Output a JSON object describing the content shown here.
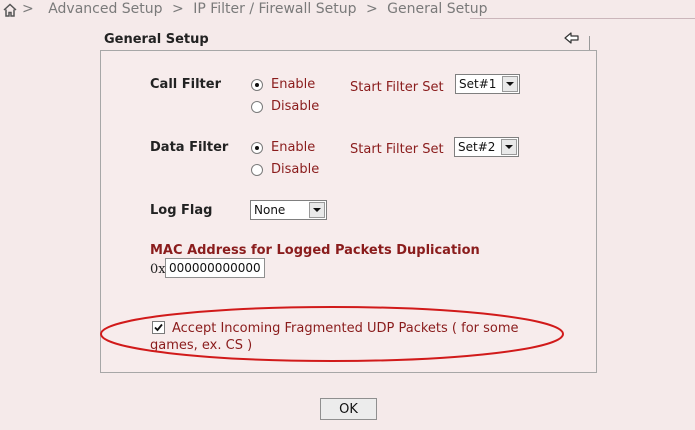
{
  "breadcrumb": {
    "items": [
      "Advanced Setup",
      "IP Filter / Firewall Setup",
      "General Setup"
    ],
    "separator": ">",
    "icon": "home-icon"
  },
  "page": {
    "title": "General Setup",
    "back_icon": "back-arrow-icon"
  },
  "call_filter": {
    "label": "Call Filter",
    "options": [
      "Enable",
      "Disable"
    ],
    "selected": "Enable",
    "start_filter_set_label": "Start Filter Set",
    "start_filter_set_value": "Set#1"
  },
  "data_filter": {
    "label": "Data Filter",
    "options": [
      "Enable",
      "Disable"
    ],
    "selected": "Enable",
    "start_filter_set_label": "Start Filter Set",
    "start_filter_set_value": "Set#2"
  },
  "log_flag": {
    "label": "Log Flag",
    "value": "None"
  },
  "mac": {
    "label": "MAC Address for Logged Packets Duplication",
    "prefix": "0x",
    "value": "000000000000"
  },
  "udp": {
    "checked": true,
    "line1": "Accept Incoming Fragmented UDP Packets ( for some",
    "line2": "games, ex. CS )"
  },
  "ok_label": "OK",
  "colors": {
    "background": "#f5eaea",
    "label_red": "#8a1c1c",
    "annotation_ellipse": "#d11a1a"
  }
}
